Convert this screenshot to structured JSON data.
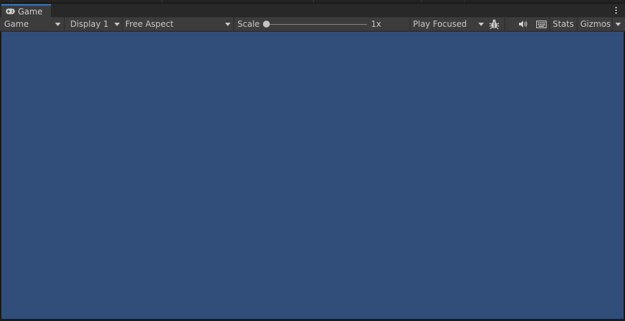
{
  "tab": {
    "title": "Game",
    "icon": "gamepad-icon"
  },
  "toolbar": {
    "view_mode": "Game",
    "display": "Display 1",
    "aspect": "Free Aspect",
    "scale_label": "Scale",
    "scale_value": "1x",
    "play_mode": "Play Focused",
    "stats_label": "Stats",
    "gizmos_label": "Gizmos"
  },
  "colors": {
    "viewport_background": "#314d79",
    "toolbar_background": "#3c3c3c",
    "tab_accent": "#3a79bb"
  }
}
